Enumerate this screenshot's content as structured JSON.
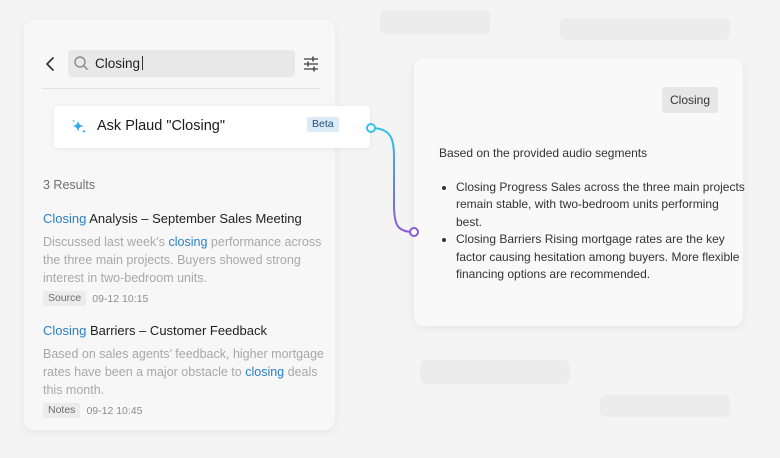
{
  "search": {
    "query": "Closing"
  },
  "ask": {
    "label": "Ask Plaud \"Closing\"",
    "badge": "Beta"
  },
  "results": {
    "count_label": "3 Results",
    "items": [
      {
        "title_highlight": "Closing",
        "title_rest": " Analysis – September Sales Meeting",
        "snippet_before": "Discussed last week’s ",
        "snippet_highlight": "closing",
        "snippet_after": " performance across the three main projects. Buyers showed strong interest in two-bedroom units.",
        "tag": "Source",
        "date": "09-12 10:15"
      },
      {
        "title_highlight": "Closing",
        "title_rest": " Barriers – Customer Feedback",
        "snippet_before": "Based on sales agents’ feedback, higher mortgage rates have been a major obstacle to ",
        "snippet_highlight": "closing",
        "snippet_after": " deals this month.",
        "tag": "Notes",
        "date": "09-12 10:45"
      }
    ]
  },
  "answer": {
    "query_chip": "Closing",
    "intro": "Based on the provided audio segments",
    "bullets": [
      "Closing Progress Sales across the three main projects remain stable, with two-bedroom units performing best.",
      "Closing Barriers Rising mortgage rates are the key factor causing hesitation among buyers. More flexible financing options are recommended."
    ]
  },
  "colors": {
    "highlight": "#2a7fc7",
    "connector_start": "#2fc3e6",
    "connector_end": "#8a5bd6"
  },
  "icons": [
    "back-arrow-icon",
    "search-icon",
    "filter-sliders-icon",
    "sparkle-icon"
  ]
}
